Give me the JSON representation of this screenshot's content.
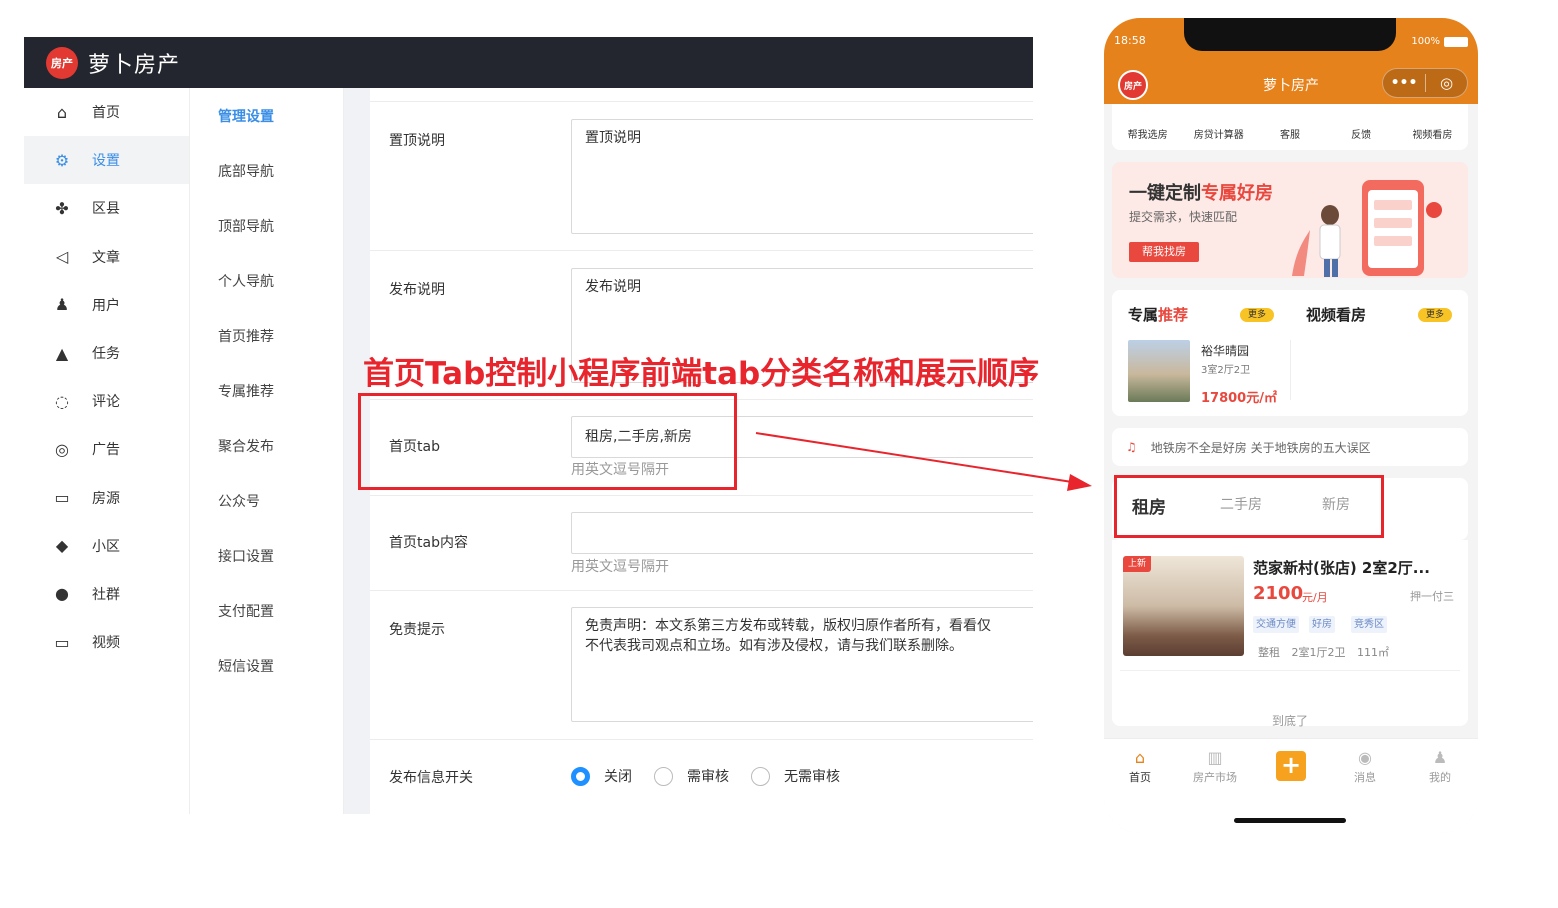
{
  "admin": {
    "app_title": "萝卜房产",
    "logo_text": "房产",
    "nav_primary": [
      {
        "label": "首页",
        "icon": "home-icon",
        "glyph": "⌂"
      },
      {
        "label": "设置",
        "icon": "gear-icon",
        "glyph": "⚙"
      },
      {
        "label": "区县",
        "icon": "grid-icon",
        "glyph": "✤"
      },
      {
        "label": "文章",
        "icon": "speaker-icon",
        "glyph": "◁"
      },
      {
        "label": "用户",
        "icon": "user-icon",
        "glyph": "♟"
      },
      {
        "label": "任务",
        "icon": "bell-icon",
        "glyph": "▲"
      },
      {
        "label": "评论",
        "icon": "comment-icon",
        "glyph": "◌"
      },
      {
        "label": "广告",
        "icon": "globe-icon",
        "glyph": "◎"
      },
      {
        "label": "房源",
        "icon": "picture-icon",
        "glyph": "▭"
      },
      {
        "label": "小区",
        "icon": "diamond-icon",
        "glyph": "◆"
      },
      {
        "label": "社群",
        "icon": "chat-icon",
        "glyph": "●"
      },
      {
        "label": "视频",
        "icon": "video-icon",
        "glyph": "▭"
      }
    ],
    "nav_primary_active": "设置",
    "nav_secondary": [
      "管理设置",
      "底部导航",
      "顶部导航",
      "个人导航",
      "首页推荐",
      "专属推荐",
      "聚合发布",
      "公众号",
      "接口设置",
      "支付配置",
      "短信设置"
    ],
    "form": {
      "top_desc_label": "置顶说明",
      "top_desc_value": "置顶说明",
      "publish_desc_label": "发布说明",
      "publish_desc_value": "发布说明",
      "home_tab_label": "首页tab",
      "home_tab_value": "租房,二手房,新房",
      "home_tab_hint": "用英文逗号隔开",
      "home_tab_content_label": "首页tab内容",
      "home_tab_content_value": "",
      "home_tab_content_hint": "用英文逗号隔开",
      "disclaimer_label": "免责提示",
      "disclaimer_value": "免责声明：本文系第三方发布或转载，版权归原作者所有，看看仅代表我司观点和立场。如有涉及侵权，请与我们联系删除。",
      "disclaimer_line1": "免责声明：本文系第三方发布或转载，版权归原作者所有，看看仅",
      "disclaimer_line2": "不代表我司观点和立场。如有涉及侵权，请与我们联系删除。",
      "publish_switch_label": "发布信息开关",
      "publish_switch_options": [
        "关闭",
        "需审核",
        "无需审核"
      ],
      "publish_switch_selected": "关闭"
    }
  },
  "annotation": {
    "text": "首页Tab控制小程序前端tab分类名称和展示顺序",
    "color": "#e8252d"
  },
  "phone": {
    "time": "18:58",
    "battery": "100%",
    "title": "萝卜房产",
    "logo_text": "房产",
    "quick_links": [
      "帮我选房",
      "房贷计算器",
      "客服",
      "反馈",
      "视频看房"
    ],
    "banner": {
      "title_plain": "一键定制",
      "title_highlight": "专属好房",
      "subtitle": "提交需求，快速匹配",
      "button": "帮我找房"
    },
    "recommend": {
      "title_plain": "专属",
      "title_highlight": "推荐",
      "more": "更多",
      "video_title": "视频看房",
      "video_more": "更多",
      "item_name": "裕华晴园",
      "item_layout": "3室2厅2卫",
      "item_price": "17800元/㎡"
    },
    "notice": "地铁房不全是好房 关于地铁房的五大误区",
    "tabs": [
      "租房",
      "二手房",
      "新房"
    ],
    "active_tab": "租房",
    "listing": {
      "badge": "上新",
      "title": "范家新村(张店) 2室2厅...",
      "price": "2100",
      "price_unit": "元/月",
      "payment": "押一付三",
      "tags": [
        "交通方便",
        "好房",
        "竞秀区"
      ],
      "meta": "整租 2室1厅2卫 111㎡"
    },
    "end_text": "到底了",
    "tabbar": [
      {
        "label": "首页",
        "icon": "home-icon",
        "glyph": "⌂"
      },
      {
        "label": "房产市场",
        "icon": "map-icon",
        "glyph": "▥"
      },
      {
        "label": "",
        "icon": "plus-icon",
        "glyph": "+"
      },
      {
        "label": "消息",
        "icon": "compass-icon",
        "glyph": "◉"
      },
      {
        "label": "我的",
        "icon": "user-icon",
        "glyph": "♟"
      }
    ],
    "accent": "#e6821b"
  }
}
